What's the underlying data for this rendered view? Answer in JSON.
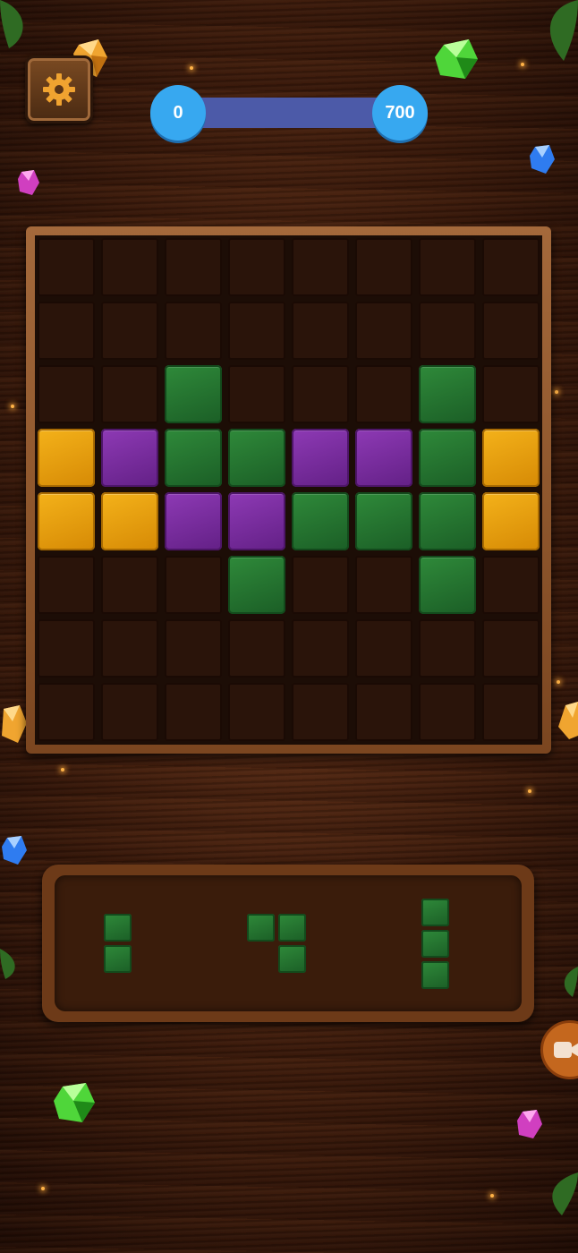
{
  "header": {
    "settings_icon": "gear-icon",
    "score_current": "0",
    "score_target": "700",
    "progress_fraction": 0.0
  },
  "board": {
    "rows": 8,
    "cols": 8,
    "cells": [
      [
        "",
        "",
        "",
        "",
        "",
        "",
        "",
        ""
      ],
      [
        "",
        "",
        "",
        "",
        "",
        "",
        "",
        ""
      ],
      [
        "",
        "",
        "green",
        "",
        "",
        "",
        "green",
        ""
      ],
      [
        "yellow",
        "purple",
        "green",
        "green",
        "purple",
        "purple",
        "green",
        "yellow"
      ],
      [
        "yellow",
        "yellow",
        "purple",
        "purple",
        "green",
        "green",
        "green",
        "yellow"
      ],
      [
        "",
        "",
        "",
        "green",
        "",
        "",
        "green",
        ""
      ],
      [
        "",
        "",
        "",
        "",
        "",
        "",
        "",
        ""
      ],
      [
        "",
        "",
        "",
        "",
        "",
        "",
        "",
        ""
      ]
    ]
  },
  "tray": {
    "pieces": [
      {
        "color": "green",
        "shape": [
          [
            1
          ],
          [
            1
          ]
        ]
      },
      {
        "color": "green",
        "shape": [
          [
            1,
            1
          ],
          [
            0,
            1
          ]
        ]
      },
      {
        "color": "green",
        "shape": [
          [
            1
          ],
          [
            1
          ],
          [
            1
          ]
        ]
      }
    ]
  },
  "colors": {
    "green": "#2f8a3a",
    "yellow": "#f4b21a",
    "purple": "#8e3ab5",
    "score_bubble": "#37a8f0",
    "progress_track": "#4c5aa8"
  },
  "side_button_icon": "video-icon"
}
